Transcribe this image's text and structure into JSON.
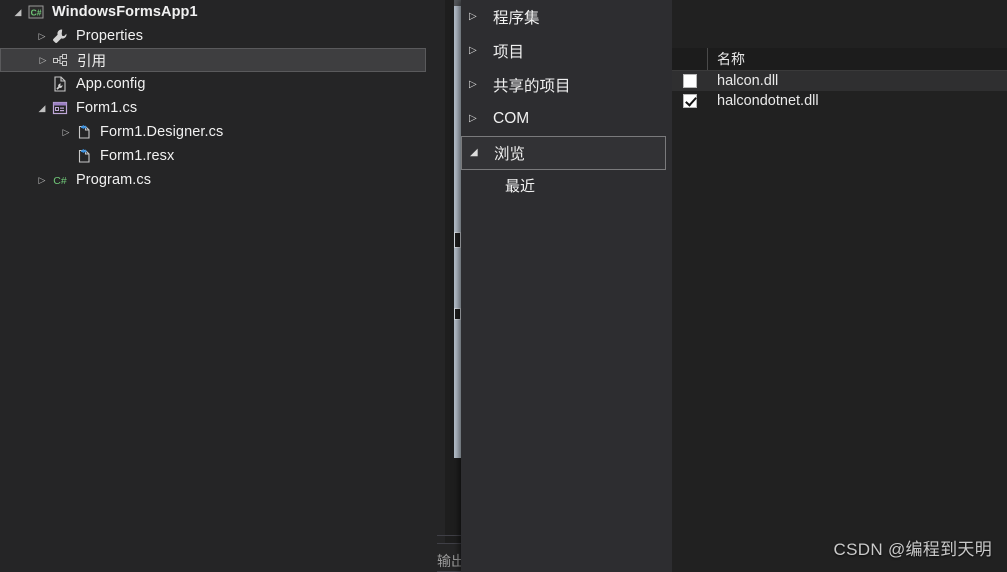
{
  "solution_explorer": {
    "items": [
      {
        "label": "WindowsFormsApp1",
        "icon": "csharp-project-icon",
        "expander": "expanded",
        "indent": 0,
        "bold": true,
        "selected": false
      },
      {
        "label": "Properties",
        "icon": "wrench-icon",
        "expander": "collapsed",
        "indent": 1,
        "bold": false,
        "selected": false
      },
      {
        "label": "引用",
        "icon": "references-icon",
        "expander": "collapsed",
        "indent": 1,
        "bold": false,
        "selected": true
      },
      {
        "label": "App.config",
        "icon": "config-file-icon",
        "expander": "none",
        "indent": 1,
        "bold": false,
        "selected": false
      },
      {
        "label": "Form1.cs",
        "icon": "windows-form-icon",
        "expander": "expanded",
        "indent": 1,
        "bold": false,
        "selected": false
      },
      {
        "label": "Form1.Designer.cs",
        "icon": "code-file-icon",
        "expander": "collapsed",
        "indent": 2,
        "bold": false,
        "selected": false
      },
      {
        "label": "Form1.resx",
        "icon": "resx-file-icon",
        "expander": "none",
        "indent": 2,
        "bold": false,
        "selected": false
      },
      {
        "label": "Program.cs",
        "icon": "csharp-file-icon",
        "expander": "collapsed",
        "indent": 1,
        "bold": false,
        "selected": false
      }
    ]
  },
  "reference_dialog": {
    "categories": [
      {
        "label": "程序集",
        "expander": "collapsed",
        "selected": false,
        "child": false
      },
      {
        "label": "项目",
        "expander": "collapsed",
        "selected": false,
        "child": false
      },
      {
        "label": "共享的项目",
        "expander": "collapsed",
        "selected": false,
        "child": false
      },
      {
        "label": "COM",
        "expander": "collapsed",
        "selected": false,
        "child": false
      },
      {
        "label": "浏览",
        "expander": "expanded",
        "selected": true,
        "child": false
      },
      {
        "label": "最近",
        "expander": "none",
        "selected": false,
        "child": true
      }
    ],
    "list": {
      "columns": [
        "",
        "名称"
      ],
      "rows": [
        {
          "checked": false,
          "name": "halcon.dll",
          "highlight": true
        },
        {
          "checked": true,
          "name": "halcondotnet.dll",
          "highlight": false
        }
      ]
    }
  },
  "ide": {
    "output_label": "输出"
  },
  "watermark": {
    "text": "CSDN @编程到天明"
  },
  "colors": {
    "panel_bg": "#252526",
    "dialog_bg": "#2d2d30",
    "list_bg": "#212121",
    "selection_bg": "#3e3e40",
    "text": "#f1f1f1",
    "csharp_green": "#70c878",
    "accent_blue": "#3a8fdd"
  }
}
